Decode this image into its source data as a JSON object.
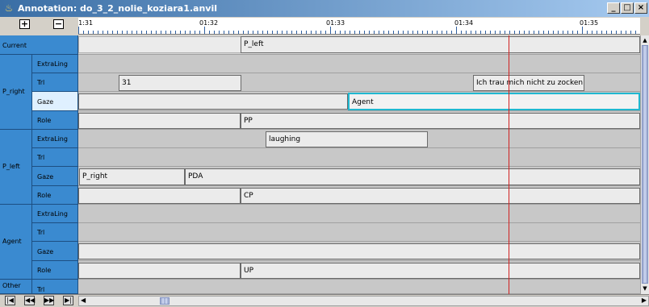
{
  "window": {
    "title": "Annotation: do_3_2_nolie_koziara1.anvil",
    "icon": "java-cup-icon",
    "controls": [
      "_",
      "□",
      "×"
    ]
  },
  "toolbar": {
    "zoom_in_label": "+",
    "zoom_out_label": "−"
  },
  "ruler": {
    "time_labels": [
      "01:31",
      "01:32",
      "01:33",
      "01:34",
      "01:35"
    ]
  },
  "groups": [
    {
      "name": "Current",
      "tracks": [
        {
          "name": "",
          "elements": [
            {
              "text": "P_left"
            }
          ]
        }
      ]
    },
    {
      "name": "P_right",
      "tracks": [
        {
          "name": "ExtraLing",
          "elements": []
        },
        {
          "name": "Trl",
          "elements": [
            {
              "text": "31"
            },
            {
              "text": "Ich trau mich nicht zu zocken"
            }
          ]
        },
        {
          "name": "Gaze",
          "selected": true,
          "elements": [
            {
              "text": ""
            },
            {
              "text": "Agent"
            }
          ]
        },
        {
          "name": "Role",
          "elements": [
            {
              "text": ""
            },
            {
              "text": "PP"
            }
          ]
        }
      ]
    },
    {
      "name": "P_left",
      "tracks": [
        {
          "name": "ExtraLing",
          "elements": [
            {
              "text": "laughing"
            }
          ]
        },
        {
          "name": "Trl",
          "elements": []
        },
        {
          "name": "Gaze",
          "elements": [
            {
              "text": "P_right"
            },
            {
              "text": "PDA"
            }
          ]
        },
        {
          "name": "Role",
          "elements": [
            {
              "text": ""
            },
            {
              "text": "CP"
            }
          ]
        }
      ]
    },
    {
      "name": "Agent",
      "tracks": [
        {
          "name": "ExtraLing",
          "elements": []
        },
        {
          "name": "Trl",
          "elements": []
        },
        {
          "name": "Gaze",
          "elements": [
            {
              "text": ""
            }
          ]
        },
        {
          "name": "Role",
          "elements": [
            {
              "text": ""
            },
            {
              "text": "UP"
            }
          ]
        }
      ]
    },
    {
      "name": "Other",
      "tracks": [
        {
          "name": "Trl",
          "elements": []
        }
      ]
    }
  ],
  "navigation": {
    "buttons": [
      "|◀",
      "◀◀",
      "▶▶",
      "▶|"
    ],
    "scroll_left": "◀",
    "scroll_right": "▶"
  },
  "colors": {
    "header_bg": "#3a8ad0",
    "selected_track": "#dff0ff",
    "selected_border": "#20b8d0",
    "playhead": "#d02020"
  }
}
